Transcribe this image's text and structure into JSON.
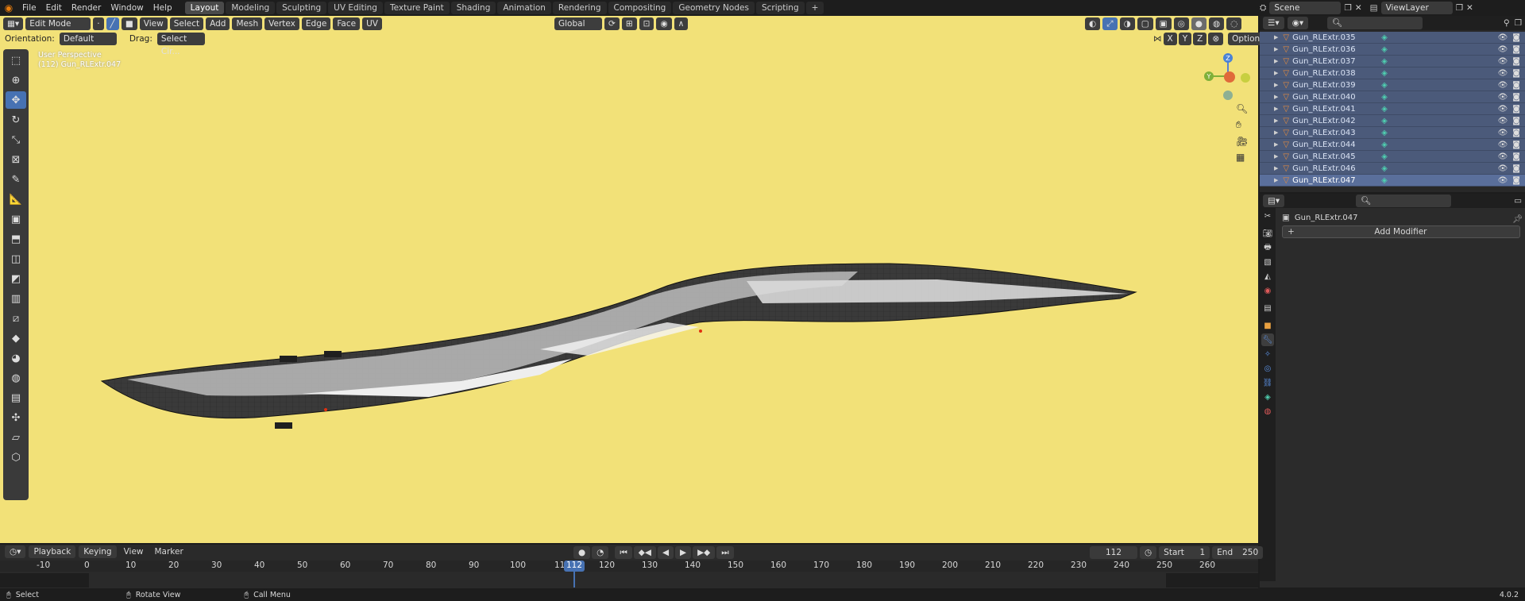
{
  "menubar": {
    "items": [
      "File",
      "Edit",
      "Render",
      "Window",
      "Help"
    ],
    "workspaces": [
      "Layout",
      "Modeling",
      "Sculpting",
      "UV Editing",
      "Texture Paint",
      "Shading",
      "Animation",
      "Rendering",
      "Compositing",
      "Geometry Nodes",
      "Scripting"
    ],
    "active_workspace": "Layout",
    "scene_label": "Scene",
    "viewlayer_label": "ViewLayer"
  },
  "viewport_header": {
    "mode": "Edit Mode",
    "menus": [
      "View",
      "Select",
      "Add",
      "Mesh",
      "Vertex",
      "Edge",
      "Face",
      "UV"
    ],
    "transform_orientation": "Global",
    "orientation_label": "Orientation:",
    "orientation_value": "Default",
    "drag_label": "Drag:",
    "drag_value": "Select Cir...",
    "axes": [
      "X",
      "Y",
      "Z"
    ],
    "options_label": "Options"
  },
  "viewport_overlay": {
    "view_name": "User Perspective",
    "object_info": "(112) Gun_RLExtr.047"
  },
  "gizmo": {
    "z_label": "Z",
    "y_label": "Y"
  },
  "outliner": {
    "rows": [
      "Gun_RLExtr.035",
      "Gun_RLExtr.036",
      "Gun_RLExtr.037",
      "Gun_RLExtr.038",
      "Gun_RLExtr.039",
      "Gun_RLExtr.040",
      "Gun_RLExtr.041",
      "Gun_RLExtr.042",
      "Gun_RLExtr.043",
      "Gun_RLExtr.044",
      "Gun_RLExtr.045",
      "Gun_RLExtr.046",
      "Gun_RLExtr.047"
    ],
    "active_row": "Gun_RLExtr.047"
  },
  "properties": {
    "object_name": "Gun_RLExtr.047",
    "add_modifier_label": "Add Modifier"
  },
  "timeline": {
    "menus": [
      "Playback",
      "Keying",
      "View",
      "Marker"
    ],
    "current_frame": "112",
    "start_label": "Start",
    "start_value": "1",
    "end_label": "End",
    "end_value": "250",
    "ruler_ticks": [
      "-10",
      "0",
      "10",
      "20",
      "30",
      "40",
      "50",
      "60",
      "70",
      "80",
      "90",
      "100",
      "11",
      "120",
      "130",
      "140",
      "150",
      "160",
      "170",
      "180",
      "190",
      "200",
      "210",
      "220",
      "230",
      "240",
      "250",
      "260"
    ]
  },
  "statusbar": {
    "select": "Select",
    "rotate": "Rotate View",
    "call_menu": "Call Menu",
    "version": "4.0.2"
  },
  "colors": {
    "viewport_bg": "#f2e178",
    "accent": "#4772b3",
    "selection_row": "#4b5a7a"
  }
}
